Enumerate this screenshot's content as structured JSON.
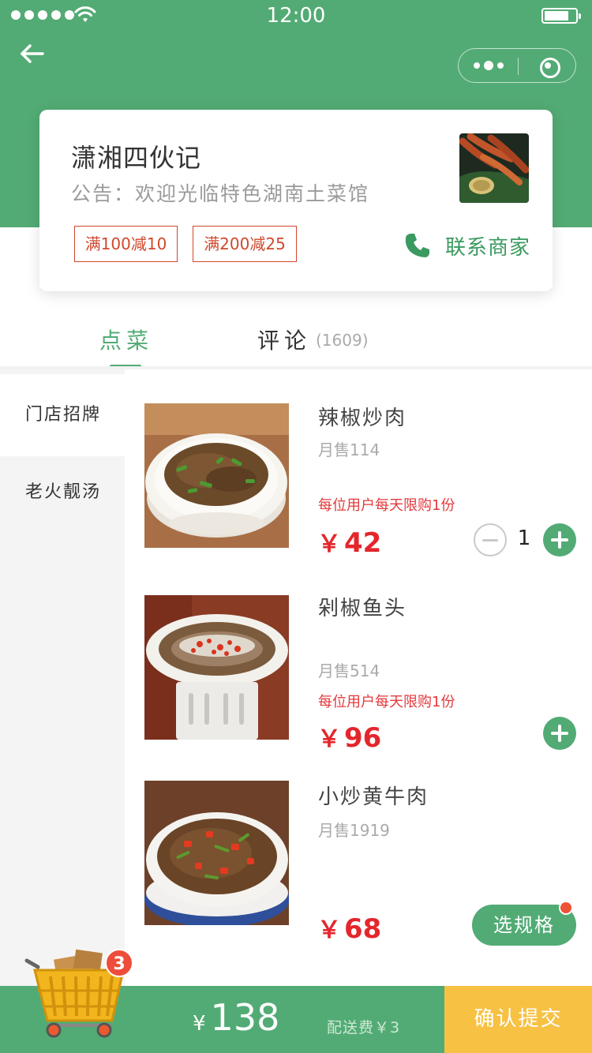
{
  "status_bar": {
    "time": "12:00"
  },
  "shop": {
    "name": "潇湘四伙记",
    "notice": "公告：欢迎光临特色湖南土菜馆",
    "coupons": [
      "满100减10",
      "满200减25"
    ],
    "contact_label": "联系商家"
  },
  "tabs": [
    {
      "label": "点菜",
      "active": true
    },
    {
      "label": "评论",
      "count": "(1609)",
      "active": false
    }
  ],
  "categories": [
    {
      "label": "门店招牌",
      "active": true
    },
    {
      "label": "老火靓汤",
      "active": false
    }
  ],
  "dishes": [
    {
      "name": "辣椒炒肉",
      "sold": "月售114",
      "limit": "每位用户每天限购1份",
      "price_symbol": "￥",
      "price": "42",
      "quantity": "1"
    },
    {
      "name": "剁椒鱼头",
      "sold": "月售514",
      "limit": "每位用户每天限购1份",
      "price_symbol": "￥",
      "price": "96"
    },
    {
      "name": "小炒黄牛肉",
      "sold": "月售1919",
      "price_symbol": "￥",
      "price": "68",
      "spec_label": "选规格"
    }
  ],
  "cart": {
    "badge_count": "3",
    "total_symbol": "¥",
    "total": "138",
    "delivery_fee": "配送费￥3",
    "submit_label": "确认提交"
  },
  "colors": {
    "brand_green": "#52ab74",
    "price_red": "#e4262c",
    "submit_yellow": "#f7c144",
    "coupon_red": "#d0482c"
  },
  "icons": [
    "wifi-icon",
    "battery-icon",
    "back-arrow-icon",
    "more-icon",
    "close-capsule-icon",
    "phone-icon",
    "minus-icon",
    "plus-icon",
    "cart-icon"
  ]
}
